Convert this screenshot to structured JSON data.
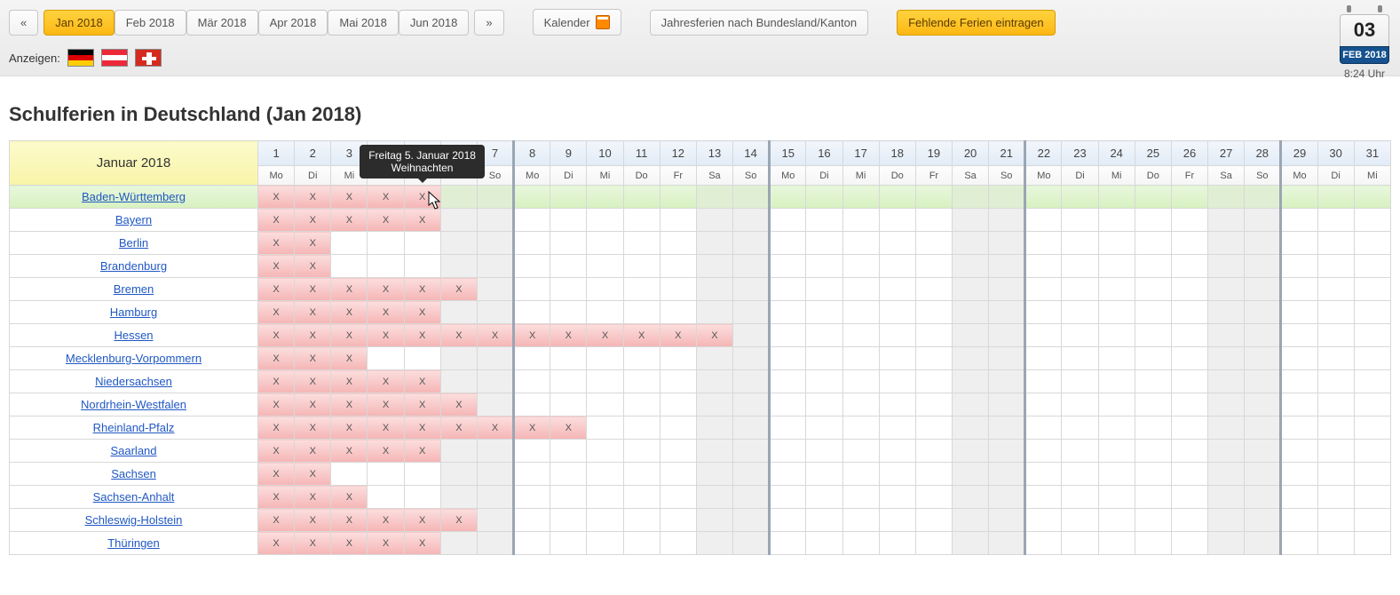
{
  "nav": {
    "prev": "«",
    "next": "»",
    "months": [
      {
        "label": "Jan 2018",
        "active": true
      },
      {
        "label": "Feb 2018",
        "active": false
      },
      {
        "label": "Mär 2018",
        "active": false
      },
      {
        "label": "Apr 2018",
        "active": false
      },
      {
        "label": "Mai 2018",
        "active": false
      },
      {
        "label": "Jun 2018",
        "active": false
      }
    ],
    "calendar_label": "Kalender",
    "yearly_label": "Jahresferien nach Bundesland/Kanton",
    "missing_label": "Fehlende Ferien eintragen"
  },
  "show": {
    "label": "Anzeigen:"
  },
  "date_widget": {
    "day": "03",
    "month": "FEB 2018",
    "time": "8:24 Uhr"
  },
  "heading": "Schulferien in Deutschland (Jan 2018)",
  "month_label": "Januar 2018",
  "weekday_abbr": [
    "Mo",
    "Di",
    "Mi",
    "Do",
    "Fr",
    "Sa",
    "So"
  ],
  "first_day_index": 0,
  "days_in_month": 31,
  "hovered_state_index": 0,
  "holiday_mark": "X",
  "tooltip": {
    "line1": "Freitag 5. Januar 2018",
    "line2": "Weihnachten",
    "day": 5
  },
  "states": [
    {
      "name": "Baden-Württemberg",
      "days": [
        1,
        2,
        3,
        4,
        5
      ]
    },
    {
      "name": "Bayern",
      "days": [
        1,
        2,
        3,
        4,
        5
      ]
    },
    {
      "name": "Berlin",
      "days": [
        1,
        2
      ]
    },
    {
      "name": "Brandenburg",
      "days": [
        1,
        2
      ]
    },
    {
      "name": "Bremen",
      "days": [
        1,
        2,
        3,
        4,
        5,
        6
      ]
    },
    {
      "name": "Hamburg",
      "days": [
        1,
        2,
        3,
        4,
        5
      ]
    },
    {
      "name": "Hessen",
      "days": [
        1,
        2,
        3,
        4,
        5,
        6,
        7,
        8,
        9,
        10,
        11,
        12,
        13
      ]
    },
    {
      "name": "Mecklenburg-Vorpommern",
      "days": [
        1,
        2,
        3
      ]
    },
    {
      "name": "Niedersachsen",
      "days": [
        1,
        2,
        3,
        4,
        5
      ]
    },
    {
      "name": "Nordrhein-Westfalen",
      "days": [
        1,
        2,
        3,
        4,
        5,
        6
      ]
    },
    {
      "name": "Rheinland-Pfalz",
      "days": [
        1,
        2,
        3,
        4,
        5,
        6,
        7,
        8,
        9
      ]
    },
    {
      "name": "Saarland",
      "days": [
        1,
        2,
        3,
        4,
        5
      ]
    },
    {
      "name": "Sachsen",
      "days": [
        1,
        2
      ]
    },
    {
      "name": "Sachsen-Anhalt",
      "days": [
        1,
        2,
        3
      ]
    },
    {
      "name": "Schleswig-Holstein",
      "days": [
        1,
        2,
        3,
        4,
        5,
        6
      ]
    },
    {
      "name": "Thüringen",
      "days": [
        1,
        2,
        3,
        4,
        5
      ]
    }
  ]
}
